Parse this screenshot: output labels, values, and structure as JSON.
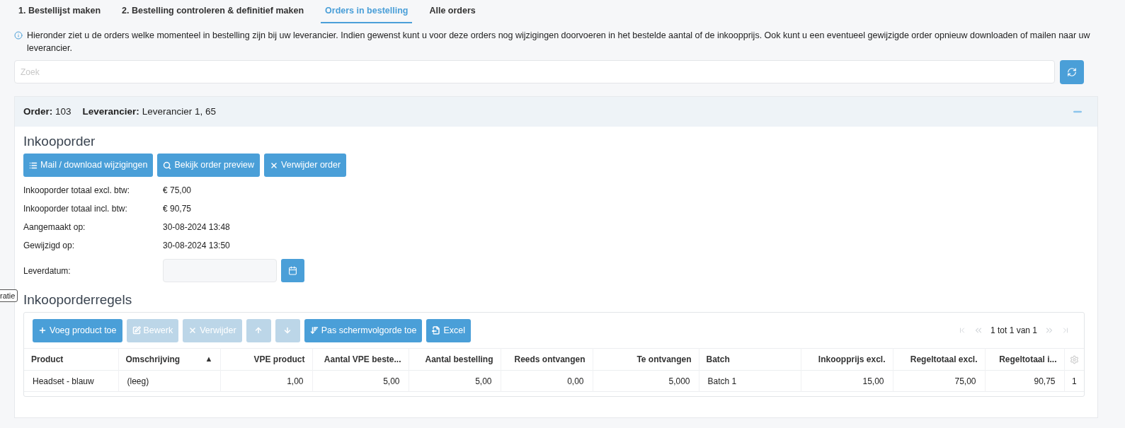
{
  "tabs": [
    {
      "label": "1. Bestellijst maken",
      "selected": false
    },
    {
      "label": "2. Bestelling controleren & definitief maken",
      "selected": false
    },
    {
      "label": "Orders in bestelling",
      "selected": true
    },
    {
      "label": "Alle orders",
      "selected": false
    }
  ],
  "info": "Hieronder ziet u de orders welke momenteel in bestelling zijn bij uw leverancier. Indien gewenst kunt u voor deze orders nog wijzigingen doorvoeren in het bestelde aantal of de inkoopprijs. Ook kunt u een eventueel gewijzigde order opnieuw downloaden of mailen naar uw leverancier.",
  "search": {
    "placeholder": "Zoek"
  },
  "order": {
    "order_label": "Order:",
    "order_value": "103",
    "supplier_label": "Leverancier:",
    "supplier_value": "Leverancier 1, 65",
    "expanded": true,
    "title": "Inkooporder",
    "buttons": [
      {
        "label": "Mail / download wijzigingen"
      },
      {
        "label": "Bekijk order preview"
      },
      {
        "label": "Verwijder order"
      }
    ],
    "fields": [
      {
        "label": "Inkooporder totaal excl. btw:",
        "value": "€ 75,00"
      },
      {
        "label": "Inkooporder totaal incl. btw:",
        "value": "€ 90,75"
      },
      {
        "label": "Aangemaakt op:",
        "value": "30-08-2024 13:48"
      },
      {
        "label": "Gewijzigd op:",
        "value": "30-08-2024 13:50"
      }
    ],
    "delivery_label": "Leverdatum:",
    "lines_title": "Inkooporderregels",
    "toolbar": [
      {
        "label": "Voeg product toe",
        "disabled": false
      },
      {
        "label": "Bewerk",
        "disabled": true
      },
      {
        "label": "Verwijder",
        "disabled": true
      },
      {
        "disabled": true
      },
      {
        "disabled": true
      },
      {
        "label": "Pas schermvolgorde toe",
        "disabled": false
      },
      {
        "label": "Excel",
        "disabled": false
      }
    ],
    "pager": {
      "text": "1 tot 1 van 1",
      "first_disabled": true,
      "prev_disabled": true,
      "next_disabled": true,
      "last_disabled": true
    },
    "columns": [
      {
        "label": "Product",
        "numeric": false
      },
      {
        "label": "Omschrijving",
        "numeric": false,
        "sort": "▲"
      },
      {
        "label": "VPE product",
        "numeric": true
      },
      {
        "label": "Aantal VPE beste...",
        "numeric": true
      },
      {
        "label": "Aantal bestelling",
        "numeric": true
      },
      {
        "label": "Reeds ontvangen",
        "numeric": true
      },
      {
        "label": "Te ontvangen",
        "numeric": true
      },
      {
        "label": "Batch",
        "numeric": false
      },
      {
        "label": "Inkoopprijs excl.",
        "numeric": true
      },
      {
        "label": "Regeltotaal excl.",
        "numeric": true
      },
      {
        "label": "Regeltotaal i...",
        "numeric": true
      }
    ],
    "rows": [
      {
        "cells": [
          "Headset - blauw",
          "(leeg)",
          "1,00",
          "5,00",
          "5,00",
          "0,00",
          "5,000",
          "Batch 1",
          "15,00",
          "75,00",
          "90,75"
        ],
        "extra": "1"
      }
    ]
  },
  "tooltip": "ratie"
}
